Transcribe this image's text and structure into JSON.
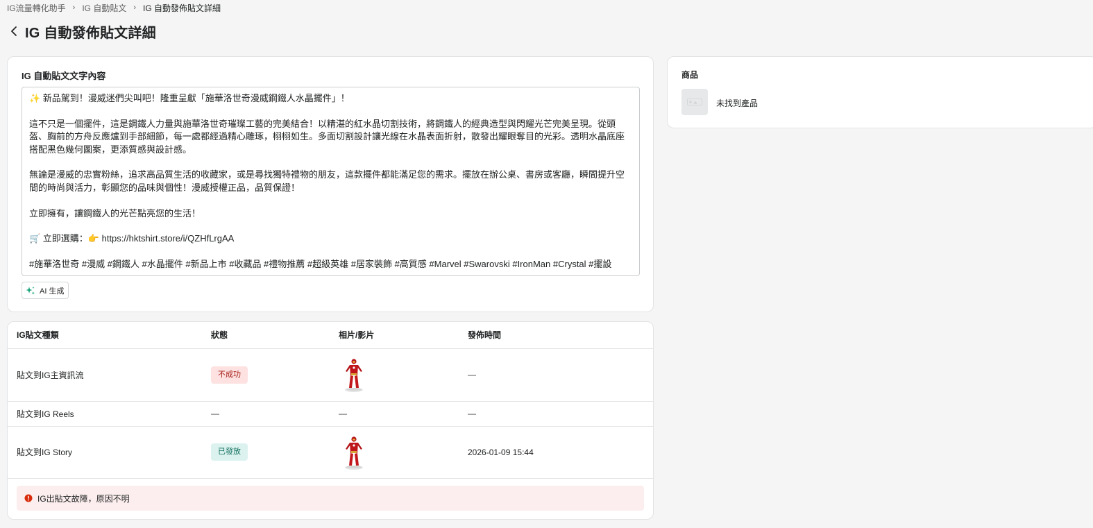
{
  "breadcrumb": {
    "items": [
      "IG流量轉化助手",
      "IG 自動貼文"
    ],
    "current": "IG 自動發佈貼文詳細"
  },
  "header": {
    "title": "IG 自動發佈貼文詳細",
    "back_icon": "chevron-left-icon"
  },
  "text_card": {
    "title": "IG 自動貼文文字內容",
    "paragraphs": [
      "✨ 新品駕到！漫威迷們尖叫吧！隆重呈獻「施華洛世奇漫威鋼鐵人水晶擺件」！",
      "這不只是一個擺件，這是鋼鐵人力量與施華洛世奇璀璨工藝的完美結合！以精湛的紅水晶切割技術，將鋼鐵人的經典造型與閃耀光芒完美呈現。從頭盔、胸前的方舟反應爐到手部細節，每一處都經過精心雕琢，栩栩如生。多面切割設計讓光線在水晶表面折射，散發出耀眼奪目的光彩。透明水晶底座搭配黑色幾何圖案，更添質感與設計感。",
      "無論是漫威的忠實粉絲，追求高品質生活的收藏家，或是尋找獨特禮物的朋友，這款擺件都能滿足您的需求。擺放在辦公桌、書房或客廳，瞬間提升空間的時尚與活力，彰顯您的品味與個性！漫威授權正品，品質保證！",
      "立即擁有，讓鋼鐵人的光芒點亮您的生活！",
      "🛒 立即選購：👉 https://hktshirt.store/i/QZHfLrgAA",
      "#施華洛世奇 #漫威 #鋼鐵人 #水晶擺件 #新品上市 #收藏品 #禮物推薦 #超級英雄 #居家裝飾 #高質感 #Marvel #Swarovski #IronMan #Crystal #擺設"
    ],
    "ai_button": {
      "label": "AI 生成",
      "icon": "sparkle-icon"
    }
  },
  "post_table": {
    "headers": [
      "IG貼文種類",
      "狀態",
      "相片/影片",
      "發佈時間"
    ],
    "rows": [
      {
        "type": "貼文到IG主資訊流",
        "status": "不成功",
        "status_kind": "fail",
        "media": "iron-man-figure-thumbnail",
        "time": "—"
      },
      {
        "type": "貼文到IG Reels",
        "status": "—",
        "status_kind": "none",
        "media": "—",
        "time": "—"
      },
      {
        "type": "貼文到IG Story",
        "status": "已發放",
        "status_kind": "success",
        "media": "iron-man-figure-thumbnail",
        "time": "2026-01-09 15:44"
      }
    ],
    "error_message": "IG出貼文故障，原因不明"
  },
  "product_card": {
    "title": "商品",
    "product_name": "未找到產品",
    "placeholder_icon": "image-placeholder-icon"
  },
  "colors": {
    "fail_bg": "#fde2e1",
    "fail_text": "#a7211a",
    "success_bg": "#dcf2ef",
    "success_text": "#0f6e5c",
    "error_banner_bg": "#fceeee",
    "error_icon": "#d82c0d",
    "ai_icon": "#16a37a"
  }
}
